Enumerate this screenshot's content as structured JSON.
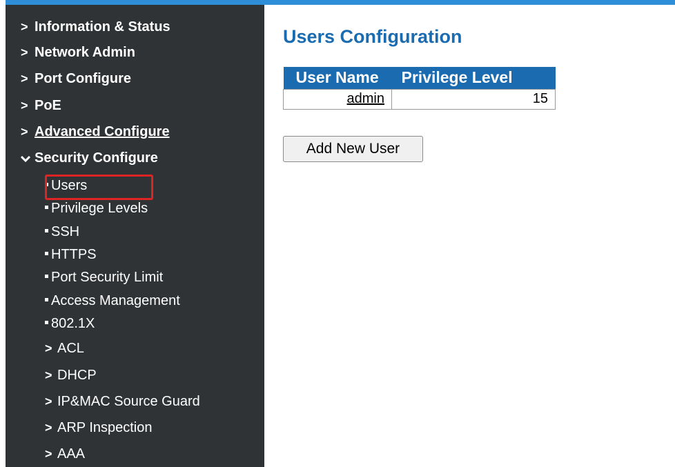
{
  "sidebar": {
    "items": [
      {
        "label": "Information & Status",
        "icon": "chevron-right-icon"
      },
      {
        "label": "Network Admin",
        "icon": "chevron-right-icon"
      },
      {
        "label": "Port Configure",
        "icon": "chevron-right-icon"
      },
      {
        "label": "PoE",
        "icon": "chevron-right-icon"
      },
      {
        "label": "Advanced Configure",
        "icon": "chevron-right-icon"
      },
      {
        "label": "Security Configure",
        "icon": "chevron-down-icon"
      }
    ],
    "security_children": [
      {
        "label": "Users"
      },
      {
        "label": "Privilege Levels"
      },
      {
        "label": "SSH"
      },
      {
        "label": "HTTPS"
      },
      {
        "label": "Port Security Limit"
      },
      {
        "label": "Access Management"
      },
      {
        "label": "802.1X"
      }
    ],
    "security_folders": [
      {
        "label": "ACL",
        "icon": "chevron-right-icon"
      },
      {
        "label": "DHCP",
        "icon": "chevron-right-icon"
      },
      {
        "label": "IP&MAC Source Guard",
        "icon": "chevron-right-icon"
      },
      {
        "label": "ARP Inspection",
        "icon": "chevron-right-icon"
      },
      {
        "label": "AAA",
        "icon": "chevron-right-icon"
      }
    ],
    "chevron_right": "›",
    "chevron_down": "⌄"
  },
  "main": {
    "title": "Users Configuration",
    "table": {
      "headers": [
        "User Name",
        "Privilege Level"
      ],
      "rows": [
        {
          "name": "admin",
          "level": "15"
        }
      ]
    },
    "add_button_label": "Add New User"
  },
  "colors": {
    "sidebar_bg": "#2f3336",
    "accent_blue": "#1b6bb0",
    "top_rule": "#2f8ed8",
    "highlight_red": "#e02424"
  }
}
